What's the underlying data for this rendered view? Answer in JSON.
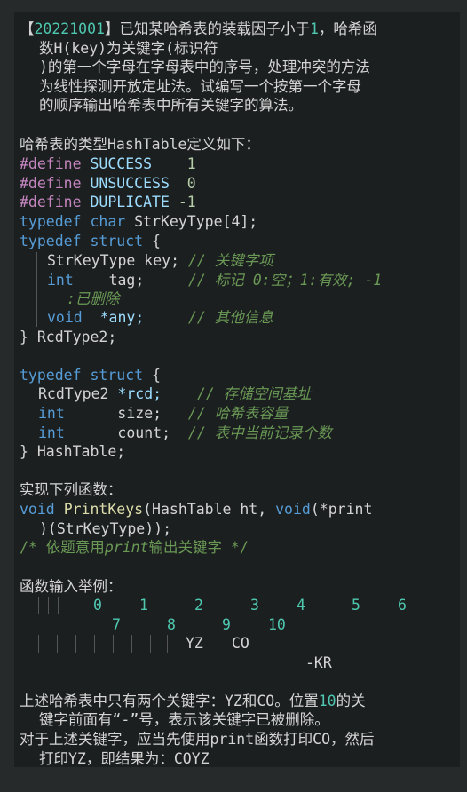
{
  "intro": {
    "l1_pre": "【",
    "l1_year": "20221001",
    "l1_post": "】已知某哈希表的装载因子小于",
    "l1_one": "1",
    "l1_end": "，哈希函",
    "l2": "数H(key)为关键字(标识符",
    "l3": ")的第一个字母在字母表中的序号，处理冲突的方法",
    "l4": "为线性探测开放定址法。试编写一个按第一个字母",
    "l5": "的顺序输出哈希表中所有关键字的算法。"
  },
  "hash_heading": "哈希表的类型HashTable定义如下：",
  "defines": [
    {
      "directive": "#define",
      "name": "SUCCESS",
      "value": "1"
    },
    {
      "directive": "#define",
      "name": "UNSUCCESS",
      "value": "0"
    },
    {
      "directive": "#define",
      "name": "DUPLICATE",
      "value": "-1"
    }
  ],
  "typedef_char": {
    "kw1": "typedef",
    "kw2": "char",
    "rest": "StrKeyType[4];"
  },
  "rcd": {
    "open_kw": "typedef",
    "open_kw2": "struct",
    "open_brace": "{",
    "f1_type": "StrKeyType",
    "f1_name": "key;",
    "f1_comment": "// 关键字项",
    "f2_type": "int",
    "f2_name": "tag;",
    "f2_comment": "// 标记 0:空；1:有效; -1",
    "f2_comment_cont": ":已删除",
    "f3_type": "void",
    "f3_name": "*any;",
    "f3_comment": "// 其他信息",
    "close": "} RcdType2;"
  },
  "table": {
    "open_kw": "typedef",
    "open_kw2": "struct",
    "open_brace": "{",
    "f1_type": "RcdType2",
    "f1_name": "*rcd;",
    "f1_comment": "// 存储空间基址",
    "f2_type": "int",
    "f2_name": "size;",
    "f2_comment": "// 哈希表容量",
    "f3_type": "int",
    "f3_name": "count;",
    "f3_comment": "// 表中当前记录个数",
    "close": "} HashTable;"
  },
  "impl_heading": "实现下列函数：",
  "func": {
    "kw": "void",
    "name": "PrintKeys",
    "params": "(HashTable ht,",
    "kw2": "void",
    "ptr": "(*print",
    "cont": ")(StrKeyType));",
    "comment_pre": "/* 依题意用",
    "comment_italic": "print",
    "comment_post": "输出关键字 */"
  },
  "example_heading": "函数输入举例：",
  "example": {
    "row1": [
      "0",
      "1",
      "2",
      "3",
      "4",
      "5",
      "6"
    ],
    "row2": [
      "7",
      "8",
      "9",
      "10"
    ],
    "row3": [
      "YZ",
      "CO"
    ],
    "row4": "-KR"
  },
  "outro": {
    "l1_pre": "上述哈希表中只有两个关键字：YZ和CO。位置",
    "l1_num": "10",
    "l1_post": "的关",
    "l2": "键字前面有“-”号，表示该关键字已被删除。",
    "l3": "对于上述关键字，应当先使用print函数打印CO，然后",
    "l4": "打印YZ，即结果为：COYZ"
  }
}
